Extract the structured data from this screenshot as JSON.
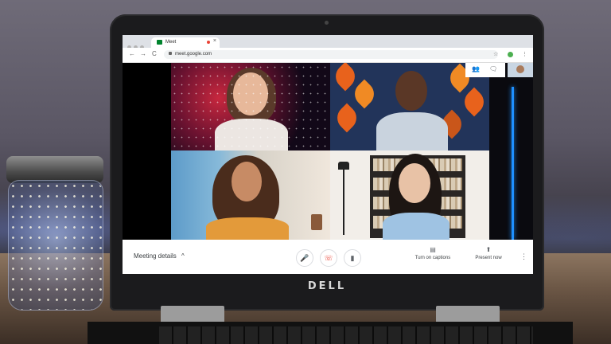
{
  "browser": {
    "tab_title": "Meet",
    "tab_close": "×",
    "url": "meet.google.com",
    "nav_back": "←",
    "nav_forward": "→",
    "nav_reload": "C",
    "star": "☆",
    "menu": "⋮"
  },
  "meet": {
    "participants": [
      {
        "position": "top-left",
        "background": "nebula"
      },
      {
        "position": "top-right",
        "background": "autumn-leaves"
      },
      {
        "position": "bottom-left",
        "background": "seaside-room"
      },
      {
        "position": "bottom-right",
        "background": "bookshelf"
      }
    ],
    "top_icons": [
      "people-icon",
      "chat-icon"
    ]
  },
  "bottom_bar": {
    "meeting_details": "Meeting details",
    "meeting_details_chevron": "^",
    "turn_on_captions": "Turn on captions",
    "present_now": "Present now",
    "more": "⋮"
  },
  "laptop": {
    "brand": "DELL"
  },
  "colors": {
    "end_call": "#ea4335",
    "accent_blue": "#1e90ff",
    "meet_green": "#00832d"
  }
}
